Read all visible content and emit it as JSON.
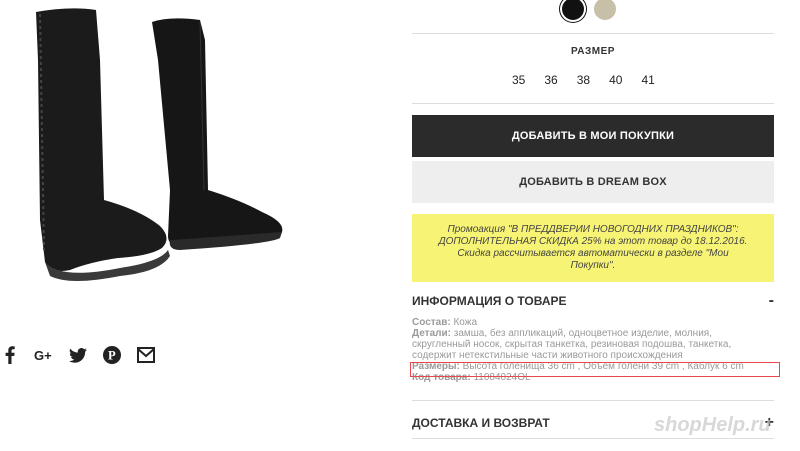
{
  "colors": [
    "black",
    "beige"
  ],
  "size": {
    "title": "РАЗМЕР",
    "options": [
      "35",
      "36",
      "38",
      "40",
      "41"
    ]
  },
  "buttons": {
    "add_to_cart": "ДОБАВИТЬ В МОИ ПОКУПКИ",
    "add_to_dreambox": "ДОБАВИТЬ В DREAM BOX"
  },
  "promo": {
    "line1": "Промоакция \"В ПРЕДДВЕРИИ НОВОГОДНИХ ПРАЗДНИКОВ\":",
    "line2": "ДОПОЛНИТЕЛЬНАЯ СКИДКА 25% на этот товар до 18.12.2016.",
    "line3": "Скидка рассчитывается автоматически в разделе \"Мои",
    "line4": "Покупки\"."
  },
  "product_info": {
    "title": "ИНФОРМАЦИЯ О ТОВАРЕ",
    "toggle": "-",
    "composition_label": "Состав:",
    "composition_value": "Кожа",
    "details_label": "Детали:",
    "details_value": "замша, без аппликаций, одноцветное изделие, молния, скругленный носок, скрытая танкетка, резиновая подошва, танкетка, содержит нетекстильные части животного происхождения",
    "sizes_label": "Размеры:",
    "sizes_value": "Высота голенища 36 cm , Объем голени 39 cm , Каблук 6 cm",
    "code_label": "Код товара:",
    "code_value": "11084024OL"
  },
  "delivery": {
    "title": "ДОСТАВКА И ВОЗВРАТ",
    "toggle": "+"
  },
  "share_icons": [
    "facebook-icon",
    "google-plus-icon",
    "twitter-icon",
    "pinterest-icon",
    "mail-icon"
  ],
  "watermark": "shopHelp.ru"
}
